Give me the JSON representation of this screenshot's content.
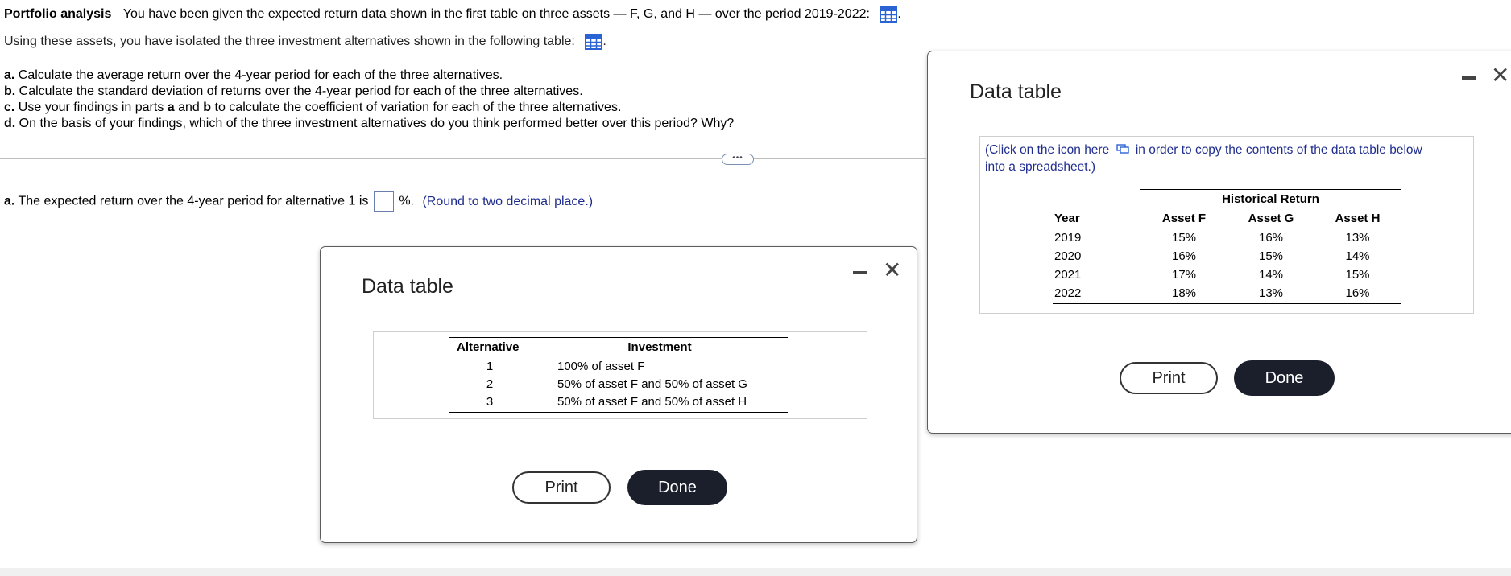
{
  "problem": {
    "title": "Portfolio analysis",
    "intro": "You have been given the expected return data shown in the first table on three assets — F, G, and H — over the period 2019-2022:",
    "line2": "Using these assets, you have isolated the three investment alternatives shown in the following table:",
    "parts": [
      {
        "letter": "a.",
        "text": "Calculate the average return over the 4-year period for each of the three alternatives."
      },
      {
        "letter": "b.",
        "text": "Calculate the standard deviation of returns over the 4-year period for each of the three alternatives."
      },
      {
        "letter": "c.",
        "text_pre": "Use your findings in parts ",
        "a": "a",
        "and": " and ",
        "b": "b",
        "text_post": " to calculate the coefficient of variation for each of the three alternatives."
      },
      {
        "letter": "d.",
        "text": "On the basis of your findings, which of the three investment alternatives do you think performed better over this period?  Why?"
      }
    ],
    "expand_label": "•••",
    "answer": {
      "letter": "a.",
      "text_pre": "The expected return over the 4-year period for alternative 1 is",
      "unit": "%.",
      "hint": "(Round to two decimal place.)",
      "value": ""
    }
  },
  "dialog_alternatives": {
    "title": "Data table",
    "headers": [
      "Alternative",
      "Investment"
    ],
    "rows": [
      {
        "alt": "1",
        "inv": "100% of asset F"
      },
      {
        "alt": "2",
        "inv": "50% of asset F and 50% of asset G"
      },
      {
        "alt": "3",
        "inv": "50% of asset F and 50% of asset H"
      }
    ],
    "print_label": "Print",
    "done_label": "Done",
    "minimize_icon": "minimize-icon",
    "close_icon": "close-icon",
    "close_glyph": "✕"
  },
  "dialog_returns": {
    "title": "Data table",
    "copy_note_pre": "(Click on the icon here",
    "copy_note_post": "in order to copy the contents of the data table below",
    "copy_note_line2": "into a spreadsheet.)",
    "group_header": "Historical Return",
    "headers": [
      "Year",
      "Asset F",
      "Asset G",
      "Asset H"
    ],
    "rows": [
      {
        "year": "2019",
        "f": "15%",
        "g": "16%",
        "h": "13%"
      },
      {
        "year": "2020",
        "f": "16%",
        "g": "15%",
        "h": "14%"
      },
      {
        "year": "2021",
        "f": "17%",
        "g": "14%",
        "h": "15%"
      },
      {
        "year": "2022",
        "f": "18%",
        "g": "13%",
        "h": "16%"
      }
    ],
    "print_label": "Print",
    "done_label": "Done",
    "close_glyph": "✕"
  },
  "colors": {
    "hint_blue": "#1f2d8f",
    "table_icon_blue": "#2a63d4",
    "done_bg": "#1a1f2b"
  }
}
